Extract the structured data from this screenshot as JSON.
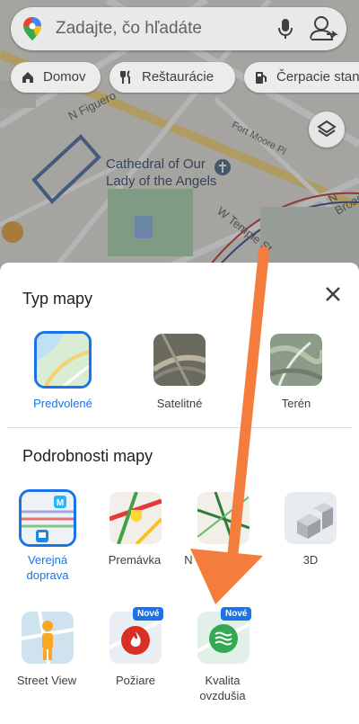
{
  "search": {
    "placeholder": "Zadajte, čo hľadáte"
  },
  "chips": [
    {
      "label": "Domov",
      "icon": "home-icon"
    },
    {
      "label": "Reštaurácie",
      "icon": "fork-knife-icon"
    },
    {
      "label": "Čerpacie stanice",
      "icon": "gas-station-icon"
    }
  ],
  "map": {
    "street_labels": [
      "N Figuero",
      "Fort Moore Pl",
      "W Temple St",
      "N Broad"
    ],
    "poi_label": "Cathedral of Our Lady of the Angels",
    "poi_line1": "Cathedral of Our",
    "poi_line2": "Lady of the Angels"
  },
  "sheet": {
    "map_type_title": "Typ mapy",
    "map_types": [
      {
        "label": "Predvolené",
        "selected": true
      },
      {
        "label": "Satelitné",
        "selected": false
      },
      {
        "label": "Terén",
        "selected": false
      }
    ],
    "details_title": "Podrobnosti mapy",
    "details_row1": [
      {
        "label_line1": "Verejná",
        "label_line2": "doprava",
        "selected": true
      },
      {
        "label_line1": "Premávka",
        "label_line2": "",
        "selected": false
      },
      {
        "label_line1": "N",
        "label_line2": "",
        "selected": false
      },
      {
        "label_line1": "3D",
        "label_line2": "",
        "selected": false
      }
    ],
    "details_row2": [
      {
        "label_line1": "Street View",
        "label_line2": "",
        "badge": ""
      },
      {
        "label_line1": "Požiare",
        "label_line2": "",
        "badge": "Nové"
      },
      {
        "label_line1": "Kvalita",
        "label_line2": "ovzdušia",
        "badge": "Nové"
      }
    ]
  },
  "colors": {
    "accent": "#1a73e8",
    "arrow": "#f47c3c"
  }
}
